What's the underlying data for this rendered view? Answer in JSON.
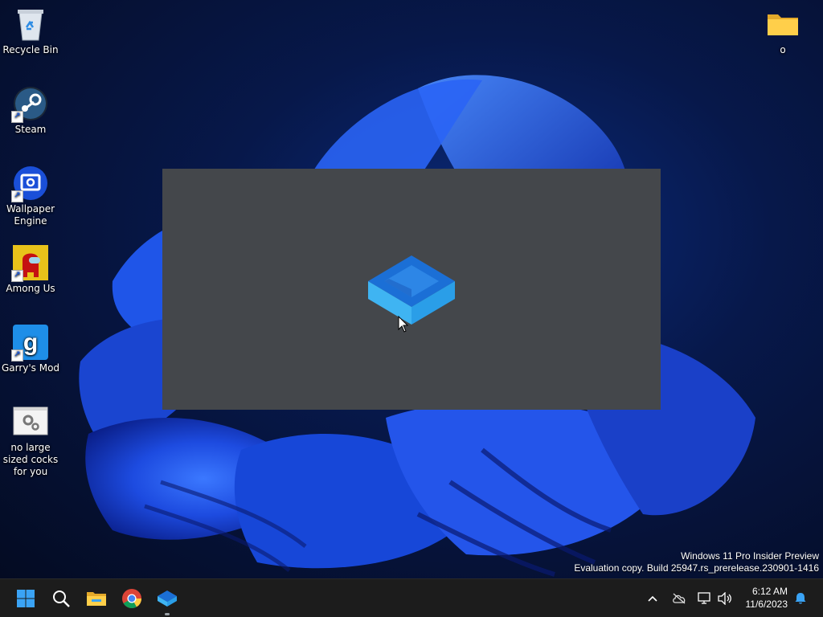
{
  "desktop": {
    "icons": [
      {
        "label": "Recycle Bin"
      },
      {
        "label": "Steam"
      },
      {
        "label": "Wallpaper Engine"
      },
      {
        "label": "Among Us"
      },
      {
        "label": "Garry's Mod"
      },
      {
        "label": "no large sized cocks for you"
      },
      {
        "label": "o"
      }
    ]
  },
  "watermark": {
    "line1": "Windows 11 Pro Insider Preview",
    "line2": "Evaluation copy. Build 25947.rs_prerelease.230901-1416"
  },
  "taskbar": {
    "pinned": [
      "start-icon",
      "search-icon",
      "file-explorer-icon",
      "chrome-icon",
      "app-box-icon"
    ],
    "clock": {
      "time": "6:12 AM",
      "date": "11/6/2023"
    }
  },
  "colors": {
    "accent": "#1a56d6",
    "splash_bg": "#44474b",
    "taskbar_bg": "#1c1c1c"
  }
}
